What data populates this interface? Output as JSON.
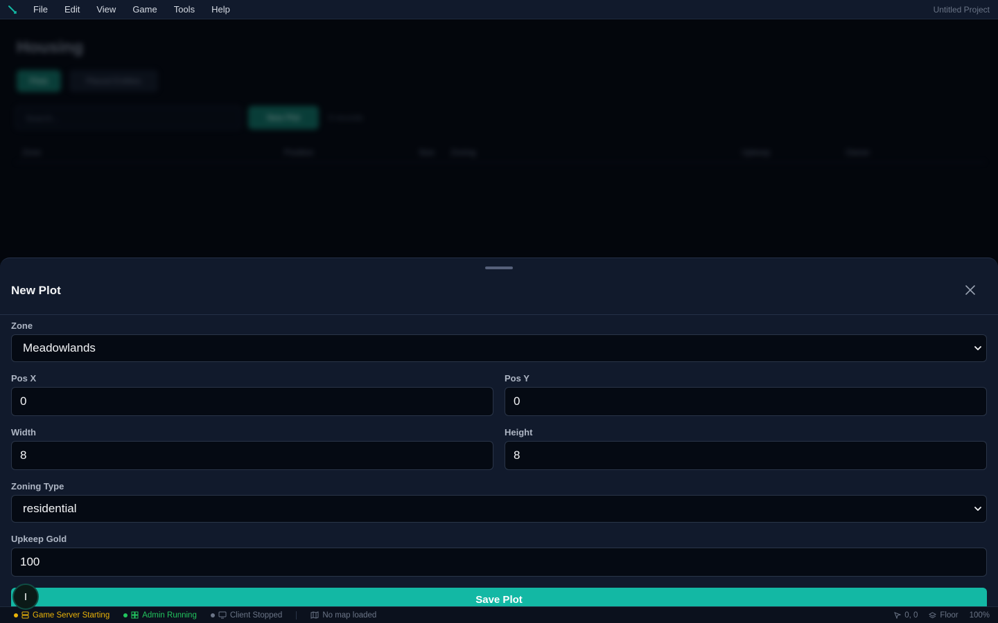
{
  "menubar": {
    "items": [
      "File",
      "Edit",
      "View",
      "Game",
      "Tools",
      "Help"
    ],
    "project_name": "Untitled Project"
  },
  "background_page": {
    "title": "Housing",
    "tabs": [
      "Plots",
      "Placed Entities"
    ],
    "search_placeholder": "Search...",
    "new_button": "New Plot",
    "count_text": "0 records",
    "columns": [
      "Zone",
      "Position",
      "Size",
      "Zoning",
      "Upkeep",
      "Owner"
    ]
  },
  "sheet": {
    "title": "New Plot",
    "fields": {
      "zone": {
        "label": "Zone",
        "value": "Meadowlands"
      },
      "pos_x": {
        "label": "Pos X",
        "value": "0"
      },
      "pos_y": {
        "label": "Pos Y",
        "value": "0"
      },
      "width": {
        "label": "Width",
        "value": "8"
      },
      "height": {
        "label": "Height",
        "value": "8"
      },
      "zoning_type": {
        "label": "Zoning Type",
        "value": "residential"
      },
      "upkeep_gold": {
        "label": "Upkeep Gold",
        "value": "100"
      }
    },
    "save_label": "Save Plot",
    "cursor_char": "I"
  },
  "statusbar": {
    "game_server": "Game Server Starting",
    "admin": "Admin Running",
    "client": "Client Stopped",
    "map": "No map loaded",
    "coords": "0, 0",
    "layer": "Floor",
    "zoom": "100%"
  },
  "colors": {
    "accent": "#13b8a4",
    "warning": "#eab308",
    "success": "#22c55e",
    "muted": "#6b7587"
  },
  "icons": {
    "logo": "brush-icon",
    "close": "close-icon",
    "chevron": "chevron-down-icon",
    "server": "server-icon",
    "admin": "grid-icon",
    "client": "monitor-icon",
    "map": "map-icon",
    "cursor": "cursor-icon",
    "layers": "layers-icon"
  }
}
